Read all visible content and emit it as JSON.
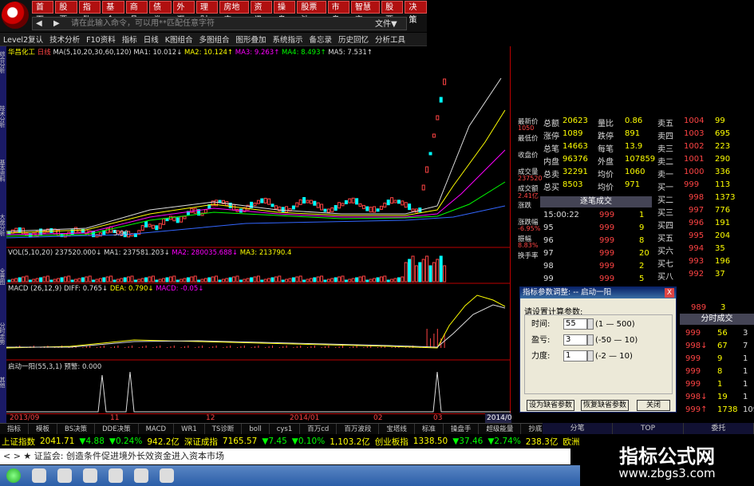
{
  "menu": [
    "首页",
    "股票",
    "指数",
    "基金",
    "商品",
    "债券",
    "外汇",
    "理财",
    "房地产",
    "资讯",
    "操盘",
    "股票池",
    "市盘",
    "智慧宝",
    "股票",
    "决策"
  ],
  "cmd": {
    "placeholder": "请在此输入命令，可以用**匹配任意字符",
    "file": "文件▼"
  },
  "toolbar": [
    "Level2复认",
    "技术分析",
    "F10资料",
    "指标",
    "日线",
    "K图组合",
    "多图组合",
    "图形叠加",
    "系统指示",
    "备忘录",
    "历史回忆",
    "分析工具"
  ],
  "leftstrip": [
    "综合分析",
    "技术分析",
    "基本资料",
    "大盘分析",
    "全景图",
    "分时走势",
    "其他"
  ],
  "chart": {
    "title": "华昌化工",
    "period": "日线",
    "ma_label": "MA(5,10,20,30,60,120)",
    "ma1": "MA1: 10.012↓",
    "ma2": "MA2: 10.124↑",
    "ma3": "MA3: 9.263↑",
    "ma4": "MA4: 8.493↑",
    "ma5": "MA5: 7.531↑",
    "low_label": "5.90",
    "vol_label": "VOL(5,10,20)",
    "vol_val": "237520.000↓",
    "vol_ma1": "MA1: 237581.203↓",
    "vol_ma2": "MA2: 280035.688↓",
    "vol_ma3": "MA3: 213790.4",
    "macd_label": "MACD (26,12,9)",
    "diff": "DIFF: 0.765↓",
    "dea": "DEA: 0.790↓",
    "macd": "MACD: -0.05↓",
    "qd_label": "启动一阳(55,3,1)",
    "qd_val": "预警: 0.000"
  },
  "xaxis": [
    "2013/09",
    "11",
    "12",
    "2014/01",
    "02",
    "03"
  ],
  "date_box": "2014/03/27",
  "quote": {
    "rows": [
      {
        "l": "总额",
        "v": "20623",
        "l2": "量比",
        "v2": "0.86",
        "s": "卖五",
        "p": "1004",
        "q": "99"
      },
      {
        "l": "涨停",
        "v": "1089",
        "l2": "跌停",
        "v2": "891",
        "s": "卖四",
        "p": "1003",
        "q": "695"
      },
      {
        "l": "总笔",
        "v": "14663",
        "l2": "每笔",
        "v2": "13.9",
        "s": "卖三",
        "p": "1002",
        "q": "223"
      },
      {
        "l": "内盘",
        "v": "96376",
        "l2": "外盘",
        "v2": "107859",
        "s": "卖二",
        "p": "1001",
        "q": "290"
      },
      {
        "l": "总卖",
        "v": "32291",
        "l2": "均价",
        "v2": "1060",
        "s": "卖一",
        "p": "1000",
        "q": "336"
      },
      {
        "l": "总买",
        "v": "8503",
        "l2": "均价",
        "v2": "971",
        "s": "买一",
        "p": "999",
        "q": "113"
      }
    ],
    "buy_rows": [
      {
        "s": "买二",
        "p": "998",
        "q": "1373"
      },
      {
        "s": "买三",
        "p": "997",
        "q": "776"
      },
      {
        "s": "买四",
        "p": "996",
        "q": "191"
      },
      {
        "s": "买五",
        "p": "995",
        "q": "204"
      },
      {
        "s": "买六",
        "p": "994",
        "q": "35"
      },
      {
        "s": "买七",
        "p": "993",
        "q": "196"
      },
      {
        "s": "买八",
        "p": "992",
        "q": "37"
      }
    ],
    "side_labels": [
      "最新价",
      "最低价",
      "收盘价",
      "成交量",
      "成交额",
      "涨跌",
      "涨跌幅",
      "振幅",
      "换手率"
    ],
    "side_values": [
      "1050",
      "",
      "",
      "237520",
      "2.41亿",
      "",
      "-6.95%",
      "8.83%",
      ""
    ],
    "trade_header": "逐笔成交",
    "trades": [
      {
        "t": "15:00:22",
        "p": "999",
        "q": "1"
      },
      {
        "t": "95",
        "p": "999",
        "q": "9"
      },
      {
        "t": "96",
        "p": "999",
        "q": "8"
      },
      {
        "t": "97",
        "p": "999",
        "q": "20"
      },
      {
        "t": "98",
        "p": "999",
        "q": "2"
      },
      {
        "t": "99",
        "p": "999",
        "q": "5"
      }
    ],
    "min_header": "分时成交",
    "mins": [
      {
        "p": "999",
        "q": "56",
        "x": "3"
      },
      {
        "p": "998↓",
        "q": "67",
        "x": "7"
      },
      {
        "p": "999",
        "q": "9",
        "x": "1"
      },
      {
        "p": "999",
        "q": "8",
        "x": "1"
      },
      {
        "p": "999",
        "q": "1",
        "x": "1"
      },
      {
        "p": "998↓",
        "q": "19",
        "x": "1"
      },
      {
        "p": "999↑",
        "q": "1738",
        "x": "109"
      }
    ],
    "last_buy": {
      "p": "989",
      "q": "3"
    }
  },
  "dialog": {
    "title": "指标参数调整: -- 启动一阳",
    "close": "X",
    "prompt": "请设置计算参数:",
    "params": [
      {
        "label": "时间:",
        "value": "55",
        "range": "(1 — 500)"
      },
      {
        "label": "盈亏:",
        "value": "3",
        "range": "(-50 — 10)"
      },
      {
        "label": "力度:",
        "value": "1",
        "range": "(-2 — 10)"
      }
    ],
    "btn_default": "设为缺省参数",
    "btn_restore": "恢复缺省参数",
    "btn_close": "关闭"
  },
  "tabs": [
    "指标",
    "模板",
    "BS决策",
    "DDE决策",
    "MACD",
    "WR1",
    "TS诊断",
    "boll",
    "cys1",
    "百万cd",
    "百万波段",
    "宝塔线",
    "标准",
    "操盘手",
    "超级能量",
    "抄底",
    "其他"
  ],
  "right_tabs": [
    "分笔",
    "TOP",
    "委托"
  ],
  "indexbar": [
    {
      "t": "上证指数",
      "c": "y"
    },
    {
      "t": "2041.71",
      "c": "y"
    },
    {
      "t": "▼4.88",
      "c": "g"
    },
    {
      "t": "▼0.24%",
      "c": "g"
    },
    {
      "t": "942.2亿",
      "c": "y"
    },
    {
      "t": "深证成指",
      "c": "y"
    },
    {
      "t": "7165.57",
      "c": "y"
    },
    {
      "t": "▼7.45",
      "c": "g"
    },
    {
      "t": "▼0.10%",
      "c": "g"
    },
    {
      "t": "1,103.2亿",
      "c": "y"
    },
    {
      "t": "创业板指",
      "c": "y"
    },
    {
      "t": "1338.50",
      "c": "y"
    },
    {
      "t": "▼37.46",
      "c": "g"
    },
    {
      "t": "▼2.74%",
      "c": "g"
    },
    {
      "t": "238.3亿",
      "c": "y"
    },
    {
      "t": "欧洲股",
      "c": "y"
    }
  ],
  "news": "<  >  ★ 证监会: 创造条件促进境外长效资金进入资本市场",
  "watermark": {
    "t1": "指标公式网",
    "t2": "www.zbgs3.com"
  }
}
